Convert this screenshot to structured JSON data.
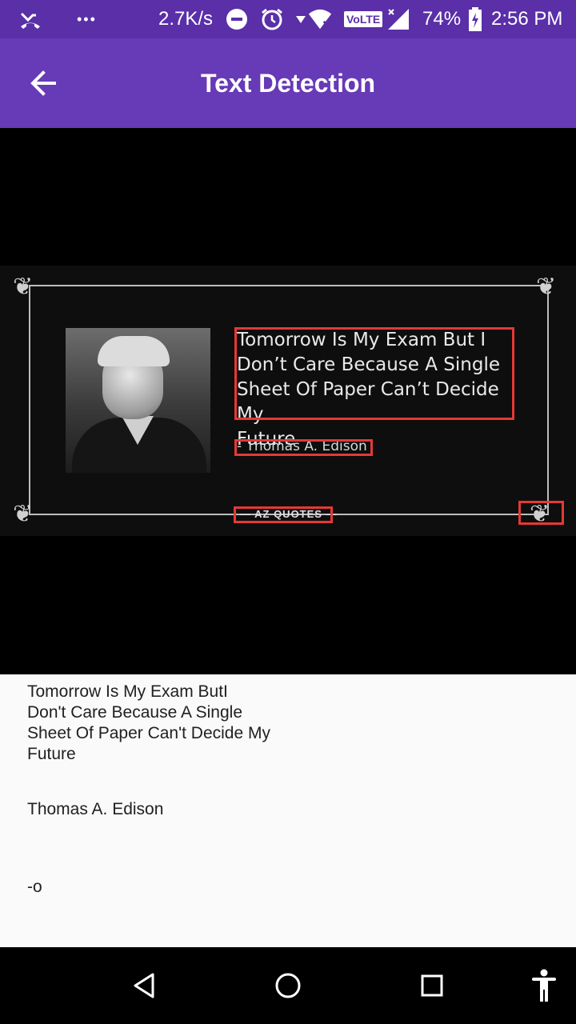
{
  "status_bar": {
    "speed": "2.7K/s",
    "volte": "VoLTE",
    "battery": "74%",
    "time": "2:56 PM",
    "dots": "•••"
  },
  "app_bar": {
    "title": "Text Detection"
  },
  "image": {
    "quote_lines": [
      "Tomorrow Is My Exam But I",
      "Don’t Care Because A Single",
      "Sheet Of Paper Can’t Decide My",
      "Future"
    ],
    "author": "- Thomas A. Edison",
    "logo": "— AZ QUOTES —"
  },
  "result": {
    "blocks": [
      [
        "Tomorrow Is My Exam ButI",
        "Don't Care Because A Single",
        "Sheet Of Paper Can't Decide My",
        "Future"
      ],
      [
        "Thomas A. Edison"
      ],
      [
        "-o"
      ]
    ]
  },
  "colors": {
    "status_bar": "#5a2fa8",
    "app_bar": "#673ab7",
    "detection_box": "#e53935",
    "result_bg": "#fafafa"
  },
  "icons": {
    "back": "arrow-left-icon",
    "nav_back": "triangle-back-icon",
    "nav_home": "circle-home-icon",
    "nav_recents": "square-recents-icon",
    "accessibility": "accessibility-icon"
  }
}
